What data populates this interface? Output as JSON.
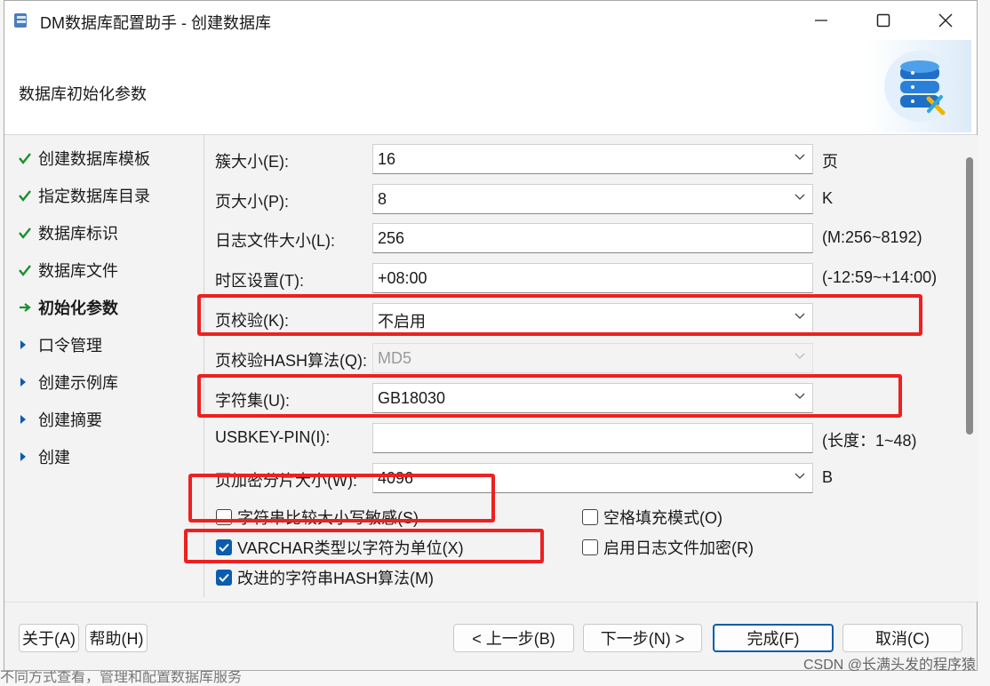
{
  "window": {
    "title": "DM数据库配置助手 - 创建数据库"
  },
  "header": {
    "title": "数据库初始化参数"
  },
  "nav": {
    "items": [
      {
        "label": "创建数据库模板",
        "state": "done"
      },
      {
        "label": "指定数据库目录",
        "state": "done"
      },
      {
        "label": "数据库标识",
        "state": "done"
      },
      {
        "label": "数据库文件",
        "state": "done"
      },
      {
        "label": "初始化参数",
        "state": "current"
      },
      {
        "label": "口令管理",
        "state": "pending"
      },
      {
        "label": "创建示例库",
        "state": "pending"
      },
      {
        "label": "创建摘要",
        "state": "pending"
      },
      {
        "label": "创建",
        "state": "pending"
      }
    ]
  },
  "form": {
    "extent_size": {
      "label": "簇大小(E):",
      "value": "16",
      "unit": "页"
    },
    "page_size": {
      "label": "页大小(P):",
      "value": "8",
      "unit": "K"
    },
    "log_size": {
      "label": "日志文件大小(L):",
      "value": "256",
      "unit": "(M:256~8192)"
    },
    "time_zone": {
      "label": "时区设置(T):",
      "value": "+08:00",
      "unit": "(-12:59~+14:00)"
    },
    "page_check": {
      "label": "页校验(K):",
      "value": "不启用"
    },
    "page_check_hash": {
      "label": "页校验HASH算法(Q):",
      "value": "MD5"
    },
    "charset": {
      "label": "字符集(U):",
      "value": "GB18030"
    },
    "usbkey_pin": {
      "label": "USBKEY-PIN(I):",
      "value": "",
      "unit": "(长度：1~48)"
    },
    "enc_slice": {
      "label": "页加密分片大小(W):",
      "value": "4096",
      "unit": "B"
    },
    "case_sensitive": {
      "label": "字符串比较大小写敏感(S)",
      "checked": false
    },
    "blank_pad": {
      "label": "空格填充模式(O)",
      "checked": false
    },
    "varchar_char": {
      "label": "VARCHAR类型以字符为单位(X)",
      "checked": true
    },
    "log_encrypt": {
      "label": "启用日志文件加密(R)",
      "checked": false
    },
    "improved_hash": {
      "label": "改进的字符串HASH算法(M)",
      "checked": true
    }
  },
  "buttons": {
    "about": "关于(A)",
    "help": "帮助(H)",
    "prev": "< 上一步(B)",
    "next": "下一步(N) >",
    "finish": "完成(F)",
    "cancel": "取消(C)"
  },
  "watermark": "CSDN @长满头发的程序猿",
  "background_text": "不同方式查看，管理和配置数据库服务",
  "colors": {
    "accent": "#0b5cad",
    "highlight": "#ee2020",
    "check_green": "#1a8f2e"
  }
}
